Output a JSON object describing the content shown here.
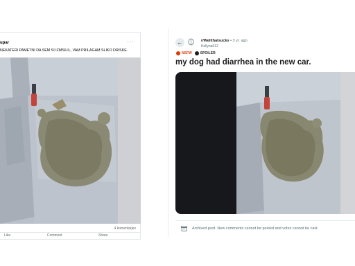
{
  "facebook_post": {
    "author": "upar",
    "more_icon": "···",
    "text": "NEKATERI PAMETNI DA SEM SI IZMSILIL, VAM PRILAGAM SLIKO DRISKE.",
    "comments": "4 komentarjev",
    "actions": [
      "Like",
      "Comment",
      "Share"
    ]
  },
  "reddit_post": {
    "back_icon": "←",
    "subreddit": "r/Wellthatsucks",
    "age": " • 3 yr. ago",
    "username": "Kellyna612",
    "badges": {
      "nsfw": "NSFW",
      "spoiler": "SPOILER"
    },
    "title": "my dog had diarrhea in the new car.",
    "archived_notice": "Archived post. New comments cannot be posted and votes cannot be cast."
  },
  "colors": {
    "nsfw": "#d93a00",
    "meta": "#576f76",
    "text": "#1c1c1c",
    "media_bg": "#16181b"
  }
}
